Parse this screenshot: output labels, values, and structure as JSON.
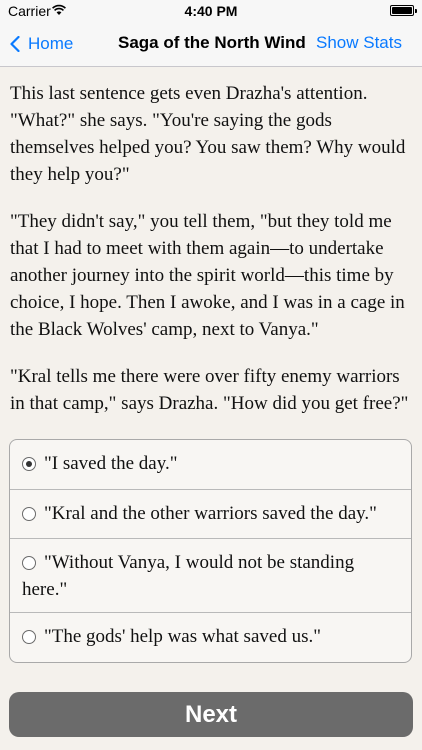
{
  "status_bar": {
    "carrier": "Carrier",
    "time": "4:40 PM",
    "battery_level": 1.0
  },
  "nav": {
    "back_label": "Home",
    "title": "Saga of the North Wind",
    "right_label": "Show Stats"
  },
  "story": {
    "paragraphs": [
      "This last sentence gets even Drazha's attention. \"What?\" she says. \"You're saying the gods themselves helped you? You saw them? Why would they help you?\"",
      "\"They didn't say,\" you tell them, \"but they told me that I had to meet with them again—to undertake another journey into the spirit world—this time by choice, I hope. Then I awoke, and I was in a cage in the Black Wolves' camp, next to Vanya.\"",
      "\"Kral tells me there were over fifty enemy warriors in that camp,\" says Drazha. \"How did you get free?\""
    ]
  },
  "choices": [
    {
      "label": "\"I saved the day.\"",
      "selected": true
    },
    {
      "label": "\"Kral and the other warriors saved the day.\"",
      "selected": false
    },
    {
      "label": "\"Without Vanya, I would not be standing here.\"",
      "selected": false
    },
    {
      "label": "\"The gods' help was what saved us.\"",
      "selected": false
    }
  ],
  "next_label": "Next"
}
